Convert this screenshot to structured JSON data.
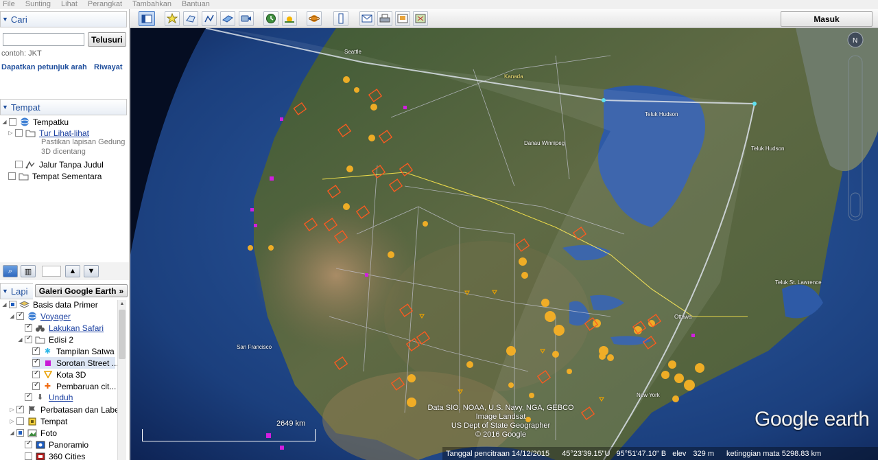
{
  "menu": [
    "File",
    "Sunting",
    "Lihat",
    "Perangkat",
    "Tambahkan",
    "Bantuan"
  ],
  "search": {
    "header": "Cari",
    "placeholder": "",
    "button": "Telusuri",
    "hint": "contoh: JKT",
    "directions": "Dapatkan petunjuk arah",
    "history": "Riwayat"
  },
  "places": {
    "header": "Tempat",
    "my_places": "Tempatku",
    "tour": "Tur Lihat-lihat",
    "tour_note": "Pastikan lapisan Gedung 3D dicentang",
    "untitled_path": "Jalur Tanpa Judul",
    "temp_places": "Tempat Sementara"
  },
  "layers": {
    "header": "Lapi",
    "gallery_button": "Galeri Google Earth",
    "items": [
      {
        "label": "Basis data Primer",
        "link": false
      },
      {
        "label": "Voyager",
        "link": true
      },
      {
        "label": "Lakukan Safari",
        "link": true
      },
      {
        "label": "Edisi 2",
        "link": false
      },
      {
        "label": "Tampilan Satwa",
        "link": false
      },
      {
        "label": "Sorotan Street ...",
        "link": false
      },
      {
        "label": "Kota 3D",
        "link": false
      },
      {
        "label": "Pembaruan cit...",
        "link": false
      },
      {
        "label": "Unduh",
        "link": true
      },
      {
        "label": "Perbatasan dan Label",
        "link": false
      },
      {
        "label": "Tempat",
        "link": false
      },
      {
        "label": "Foto",
        "link": false
      },
      {
        "label": "Panoramio",
        "link": false
      },
      {
        "label": "360 Cities",
        "link": false
      }
    ]
  },
  "toolbar": {
    "signin": "Masuk",
    "icons": [
      "sidebar-toggle-icon",
      "placemark-icon",
      "polygon-icon",
      "path-icon",
      "image-overlay-icon",
      "record-tour-icon",
      "historical-imagery-icon",
      "sunlight-icon",
      "planets-icon",
      "ruler-icon",
      "email-icon",
      "print-icon",
      "save-image-icon",
      "maps-icon"
    ]
  },
  "map": {
    "labels": {
      "canada": "Kanada",
      "hudson_bay": "Teluk Hudson",
      "lake_winnipeg": "Danau Winnipeg",
      "hudson_strait": "Teluk Hudson",
      "ottawa": "Ottawa",
      "gulf": "Teluk St. Lawrence",
      "seattle": "Seattle",
      "san_francisco": "San Francisco",
      "new_york": "New York"
    },
    "attribution": [
      "Data SIO, NOAA, U.S. Navy, NGA, GEBCO",
      "Image Landsat",
      "US Dept of State Geographer",
      "© 2016 Google"
    ],
    "scale": "2649 km",
    "logo": "Google earth",
    "status": {
      "imagery_date": "Tanggal pencitraan 14/12/2015",
      "lat": "45°23'39.15\"U",
      "lon": "95°51'47.10\" B",
      "elev_label": "elev",
      "elev": "329 m",
      "eye_alt": "ketinggian mata 5298.83 km"
    }
  }
}
